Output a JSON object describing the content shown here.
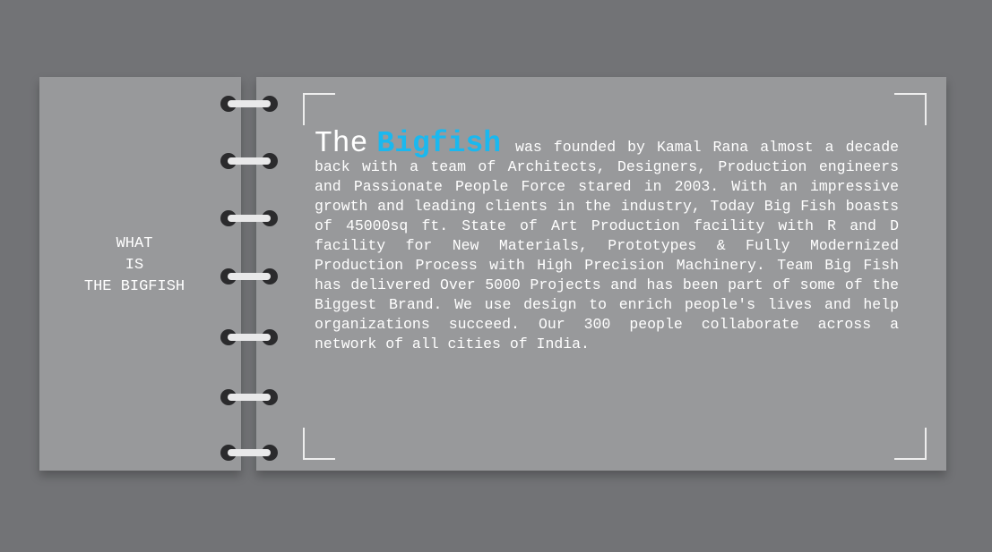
{
  "side": {
    "title_lines": [
      "WHAT",
      "IS",
      "THE BIGFISH"
    ]
  },
  "about": {
    "prefix": "The",
    "brand": "Bigfish",
    "body": "was founded by Kamal Rana almost a decade back with a team of Architects, Designers, Production engineers and Passionate People Force stared in 2003. With an impressive growth and leading clients in the industry, Today Big Fish boasts of 45000sq ft. State of Art Production facility with R and D facility for New Materials, Prototypes & Fully Modernized Production Process with High Precision Machinery. Team Big Fish has delivered Over 5000 Projects and has been part of some of the Biggest Brand. We use design to enrich people's lives and help organizations succeed. Our 300 people collaborate across a network of all cities of India."
  },
  "colors": {
    "background": "#727376",
    "page": "#98999b",
    "brand_accent": "#1ab8ef",
    "text": "#ffffff"
  },
  "icons": [
    "spiral-ring-icon",
    "corner-bracket-icon"
  ]
}
